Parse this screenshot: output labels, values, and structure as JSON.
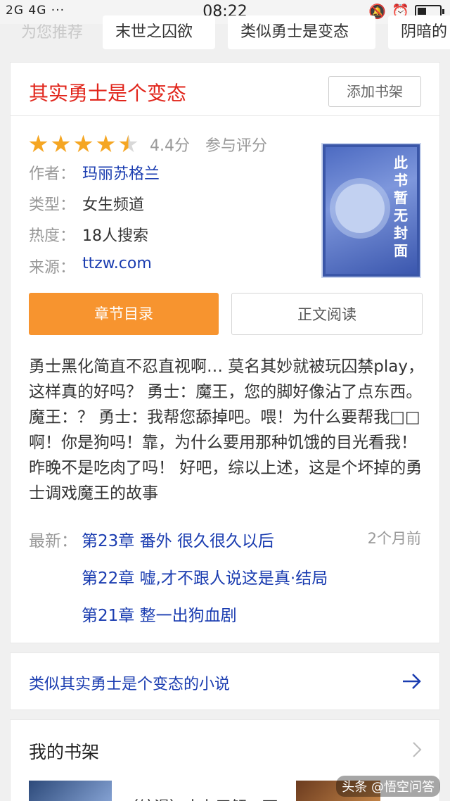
{
  "status_bar": {
    "signal_text": "2G 4G",
    "time": "08:22",
    "more_icon": "dots-icon"
  },
  "recommend": {
    "label": "为您推荐",
    "chips": [
      "末世之囚欲",
      "类似勇士是变态",
      "阴暗的"
    ]
  },
  "book": {
    "title": "其实勇士是个变态",
    "add_shelf_label": "添加书架",
    "rating": {
      "stars": 4.5,
      "max": 5,
      "score_text": "4.4分",
      "rate_link": "参与评分"
    },
    "info": [
      {
        "label": "作者：",
        "value": "玛丽苏格兰",
        "link": true
      },
      {
        "label": "类型：",
        "value": "女生频道",
        "link": false
      },
      {
        "label": "热度：",
        "value": "18人搜索",
        "link": false
      },
      {
        "label": "来源：",
        "value": "ttzw.com",
        "link": true
      }
    ],
    "cover_text": "此书暂无封面",
    "catalog_button": "章节目录",
    "read_button": "正文阅读",
    "description": "勇士黑化简直不忍直视啊… 莫名其妙就被玩囚禁play，这样真的好吗？ 勇士：魔王，您的脚好像沾了点东西。魔王：？ 勇士：我帮您舔掉吧。喂！为什么要帮我□□啊！你是狗吗！靠，为什么要用那种饥饿的目光看我！昨晚不是吃肉了吗！ 好吧，综以上述，这是个坏掉的勇士调戏魔王的故事",
    "latest_label": "最新：",
    "latest_time": "2个月前",
    "chapters": [
      "第23章 番外 很久很久以后",
      "第22章 嘘,才不跟人说这是真·结局",
      "第21章 整一出狗血剧"
    ]
  },
  "similar": {
    "text": "类似其实勇士是个变态的小说"
  },
  "shelf": {
    "title": "我的书架",
    "partial_item": "（综漫）本丸了解一下"
  },
  "watermark": "头条 @悟空问答"
}
